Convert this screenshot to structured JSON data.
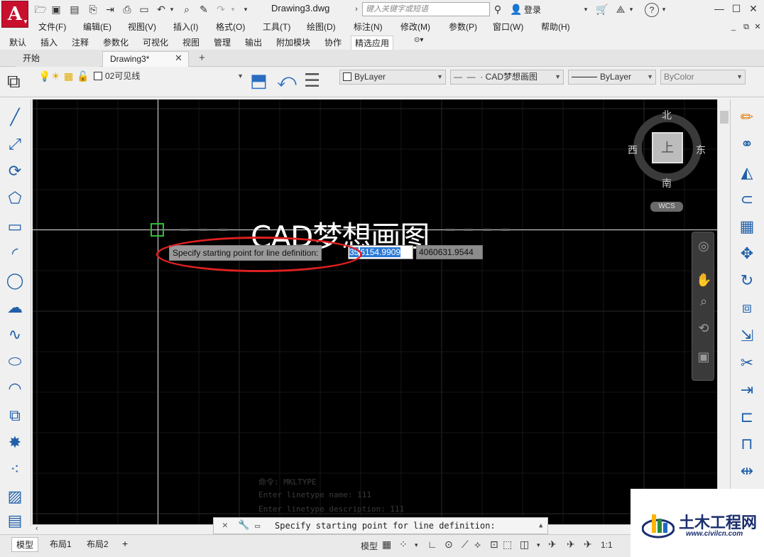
{
  "titlebar": {
    "document_title": "Drawing3.dwg",
    "search_placeholder": "键入关键字或短语",
    "login_label": "登录",
    "help_glyph": "?"
  },
  "menu": [
    "文件(F)",
    "编辑(E)",
    "视图(V)",
    "插入(I)",
    "格式(O)",
    "工具(T)",
    "绘图(D)",
    "标注(N)",
    "修改(M)",
    "参数(P)",
    "窗口(W)",
    "帮助(H)"
  ],
  "ribbon_tabs": [
    "默认",
    "插入",
    "注释",
    "参数化",
    "可视化",
    "视图",
    "管理",
    "输出",
    "附加模块",
    "协作",
    "精选应用"
  ],
  "ribbon_active_tab": "精选应用",
  "doc_tabs": [
    "开始",
    "Drawing3*"
  ],
  "toolbar": {
    "layer_combo": "02可见线",
    "color_combo": "ByLayer",
    "linetype_combo": "CAD梦想画图",
    "lineweight_combo": "ByLayer",
    "plotstyle_combo": "ByColor"
  },
  "canvas": {
    "linetype_text": "CAD梦想画图",
    "prompt": "Specify starting point for line definition:",
    "x_selected": "35",
    "x_rest": "6154.9909",
    "y_value": "4060631.9544"
  },
  "viewcube": {
    "north": "北",
    "south": "南",
    "east": "东",
    "west": "西",
    "face": "上",
    "wcs": "WCS"
  },
  "command_history": [
    "命令: MKLTYPE",
    "Enter linetype name: 111",
    "Enter linetype description: 111"
  ],
  "command_line": "Specify starting point for line definition:",
  "layout_tabs": [
    "模型",
    "布局1",
    "布局2"
  ],
  "statusbar": {
    "model_label": "模型",
    "scale": "1:1"
  },
  "watermark": {
    "name": "土木工程网",
    "url": "www.civilcn.com"
  }
}
